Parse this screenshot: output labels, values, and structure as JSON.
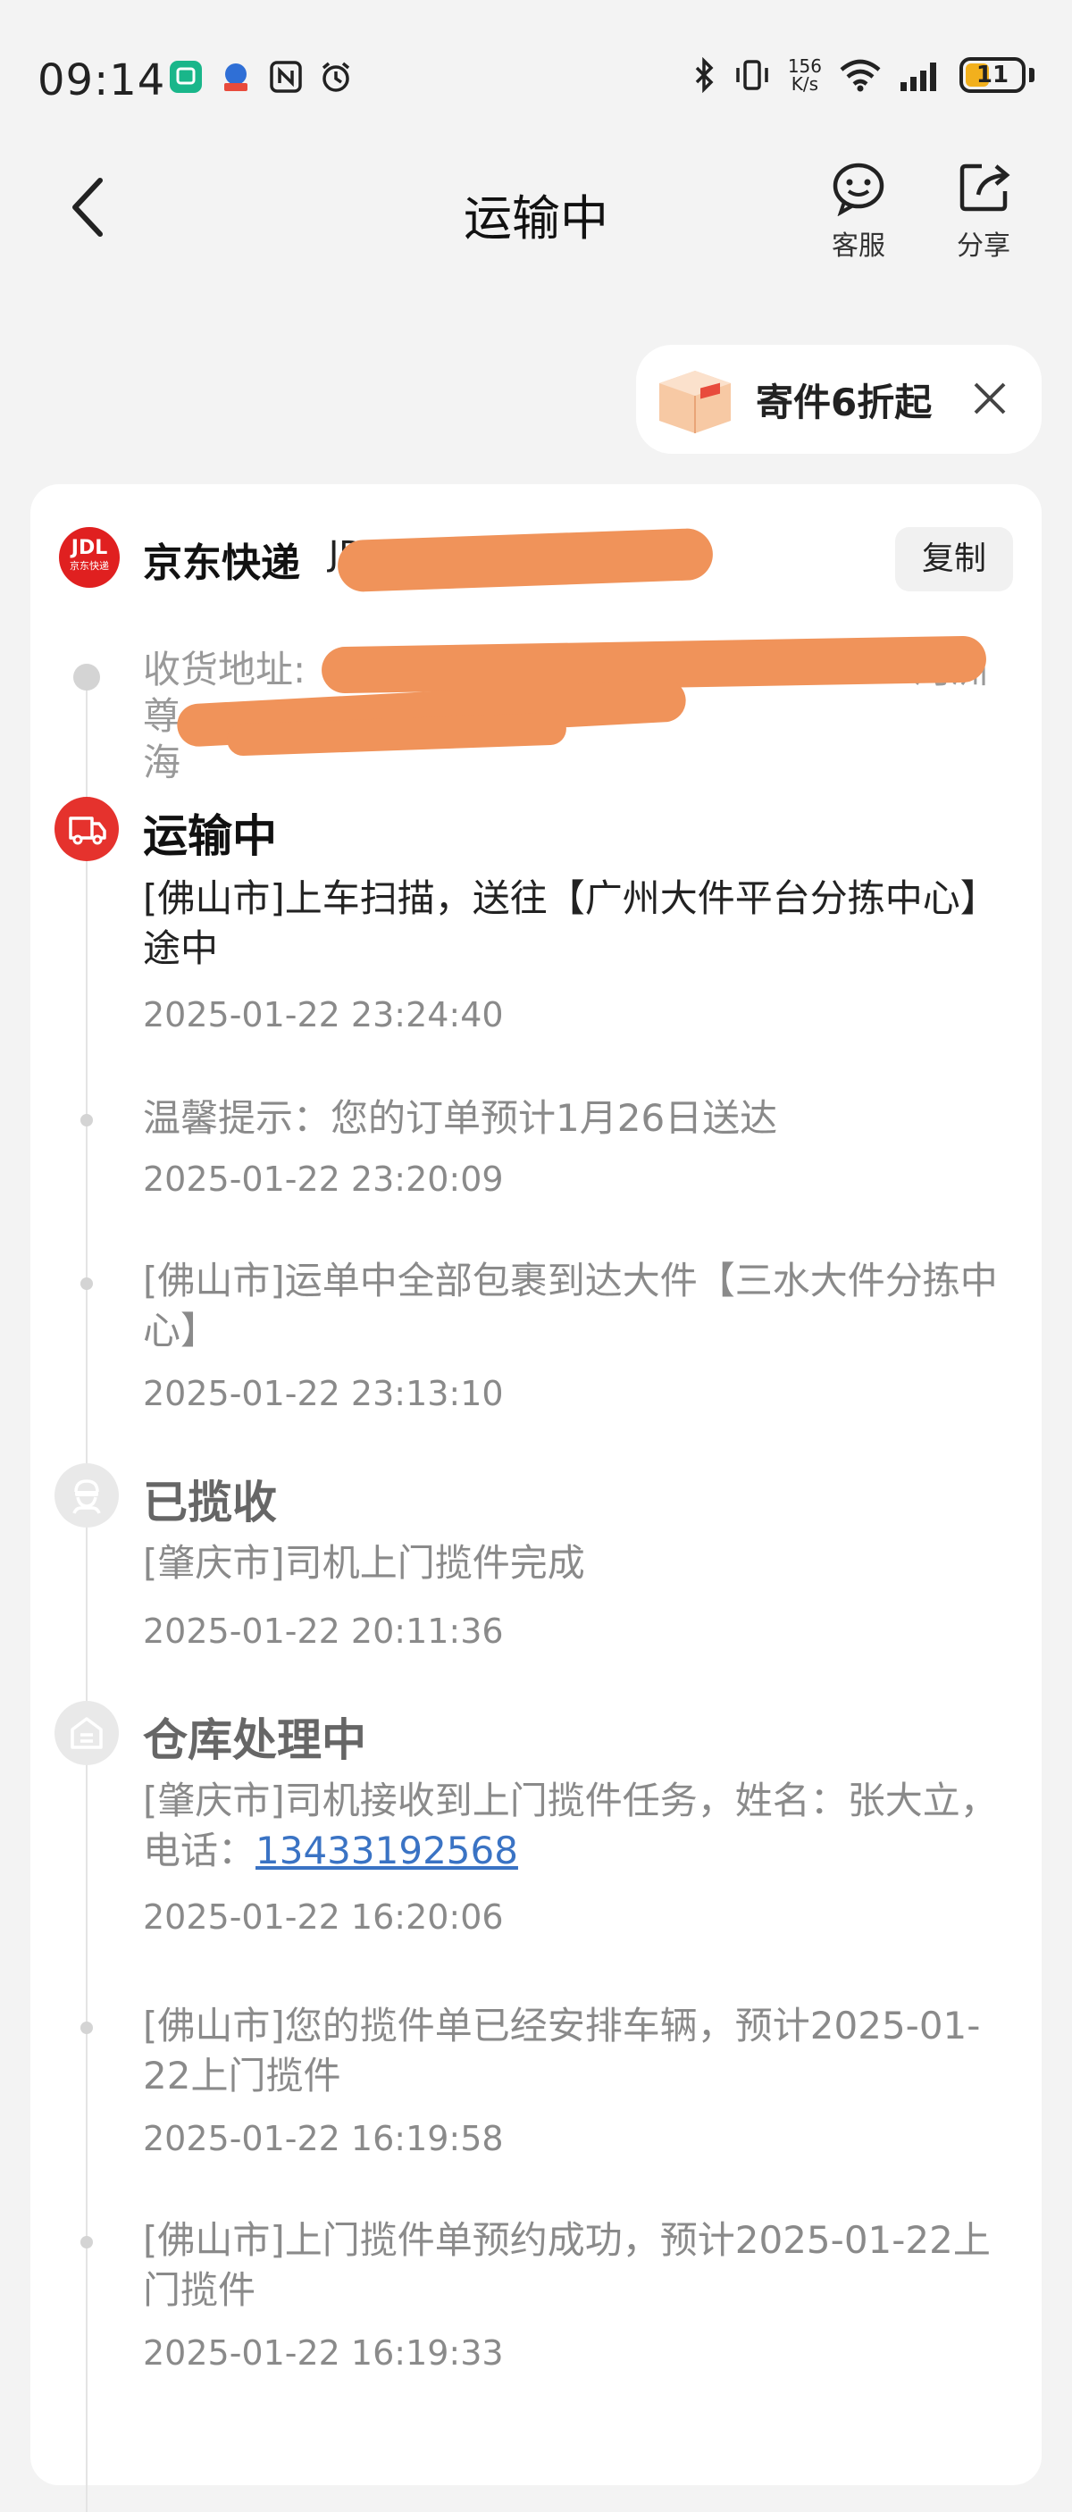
{
  "status_bar": {
    "time": "09:14",
    "net_speed_value": "156",
    "net_speed_unit": "K/s",
    "battery": "11"
  },
  "header": {
    "title": "运输中",
    "service_label": "客服",
    "share_label": "分享"
  },
  "promo": {
    "text": "寄件6折起"
  },
  "shipment": {
    "carrier": "京东快递",
    "tracking_visible": "JD",
    "copy_label": "复制",
    "address_prefix": "收货地址:",
    "address_tail_line1": "河洲尊",
    "address_tail_line2": "海"
  },
  "timeline": [
    {
      "status": "运输中",
      "text": "[佛山市]上车扫描，送往【广州大件平台分拣中心】途中",
      "time": "2025-01-22 23:24:40"
    },
    {
      "text": "温馨提示：您的订单预计1月26日送达",
      "time": "2025-01-22 23:20:09"
    },
    {
      "text": "[佛山市]运单中全部包裹到达大件【三水大件分拣中心】",
      "time": "2025-01-22 23:13:10"
    },
    {
      "status": "已揽收",
      "text": "[肇庆市]司机上门揽件完成",
      "time": "2025-01-22 20:11:36"
    },
    {
      "status": "仓库处理中",
      "text": "[肇庆市]司机接收到上门揽件任务，姓名：张大立，电话：",
      "phone": "13433192568",
      "time": "2025-01-22 16:20:06"
    },
    {
      "text": "[佛山市]您的揽件单已经安排车辆，预计2025-01-22上门揽件",
      "time": "2025-01-22 16:19:58"
    },
    {
      "text": "[佛山市]上门揽件单预约成功，预计2025-01-22上门揽件",
      "time": "2025-01-22 16:19:33"
    }
  ],
  "icons": [
    "back-arrow-icon",
    "smiley-service-icon",
    "share-icon",
    "package-box-icon",
    "close-icon",
    "truck-icon",
    "courier-icon",
    "warehouse-icon"
  ],
  "colors": {
    "accent_red": "#e5322d",
    "redaction": "#f0935a",
    "link_blue": "#3a73c4",
    "battery_yellow": "#f2b01d"
  }
}
